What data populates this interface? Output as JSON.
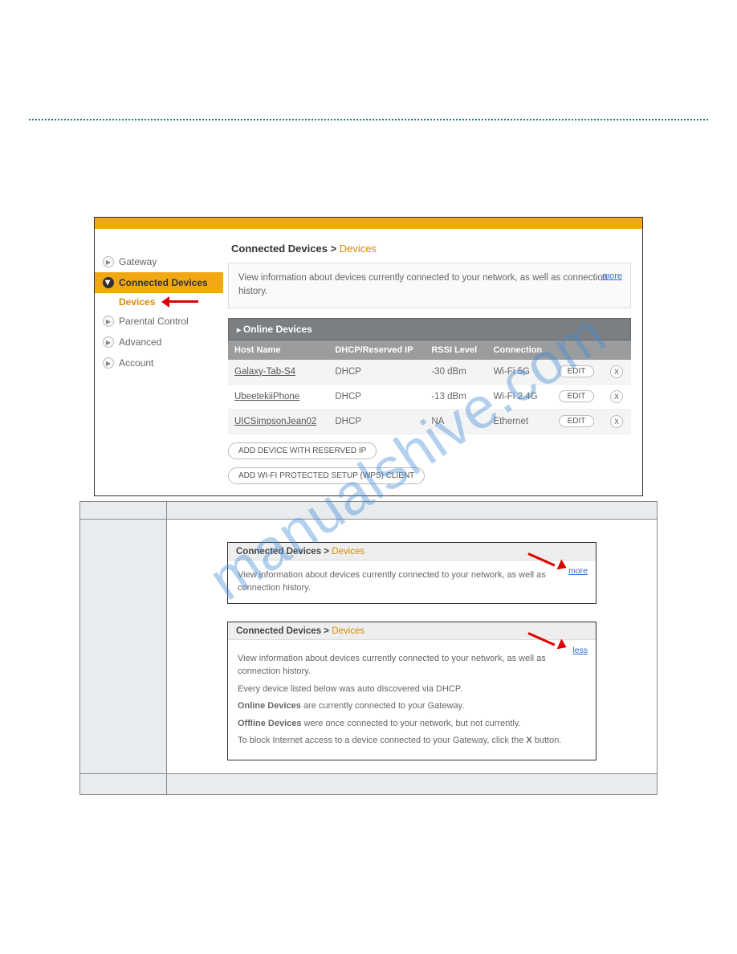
{
  "sidebar": {
    "items": [
      {
        "label": "Gateway"
      },
      {
        "label": "Connected Devices"
      },
      {
        "label": "Parental Control"
      },
      {
        "label": "Advanced"
      },
      {
        "label": "Account"
      }
    ],
    "sub": "Devices"
  },
  "crumb": {
    "root": "Connected Devices",
    "current": "Devices"
  },
  "info": {
    "text": "View information about devices currently connected to your network, as well as connection history.",
    "more": "more"
  },
  "table": {
    "title": "Online Devices",
    "headers": [
      "Host Name",
      "DHCP/Reserved IP",
      "RSSI Level",
      "Connection"
    ],
    "rows": [
      {
        "host": "Galaxy-Tab-S4",
        "dhcp": "DHCP",
        "rssi": "-30 dBm",
        "conn": "Wi-Fi 5G"
      },
      {
        "host": "UbeetekiiPhone",
        "dhcp": "DHCP",
        "rssi": "-13 dBm",
        "conn": "Wi-Fi 2.4G"
      },
      {
        "host": "UICSimpsonJean02",
        "dhcp": "DHCP",
        "rssi": "NA",
        "conn": "Ethernet"
      }
    ],
    "edit": "EDIT",
    "x": "X",
    "addReserved": "ADD DEVICE WITH RESERVED IP",
    "addWPS": "ADD WI-FI PROTECTED SETUP (WPS) CLIENT"
  },
  "mini1": {
    "lnk": "more",
    "body": "View information about devices currently connected to your network, as well as connection history."
  },
  "mini2": {
    "lnk": "less",
    "lines": [
      "View information about devices currently connected to your network, as well as connection history.",
      "Every device listed below was auto discovered via DHCP.",
      "Online Devices are currently connected to your Gateway.",
      "Offline Devices were once connected to your network, but not currently.",
      "To block Internet access to a device connected to your Gateway, click the X button."
    ],
    "boldOnline": "Online Devices",
    "boldOffline": "Offline Devices",
    "boldX": "X"
  },
  "watermark": "manualshive.com"
}
